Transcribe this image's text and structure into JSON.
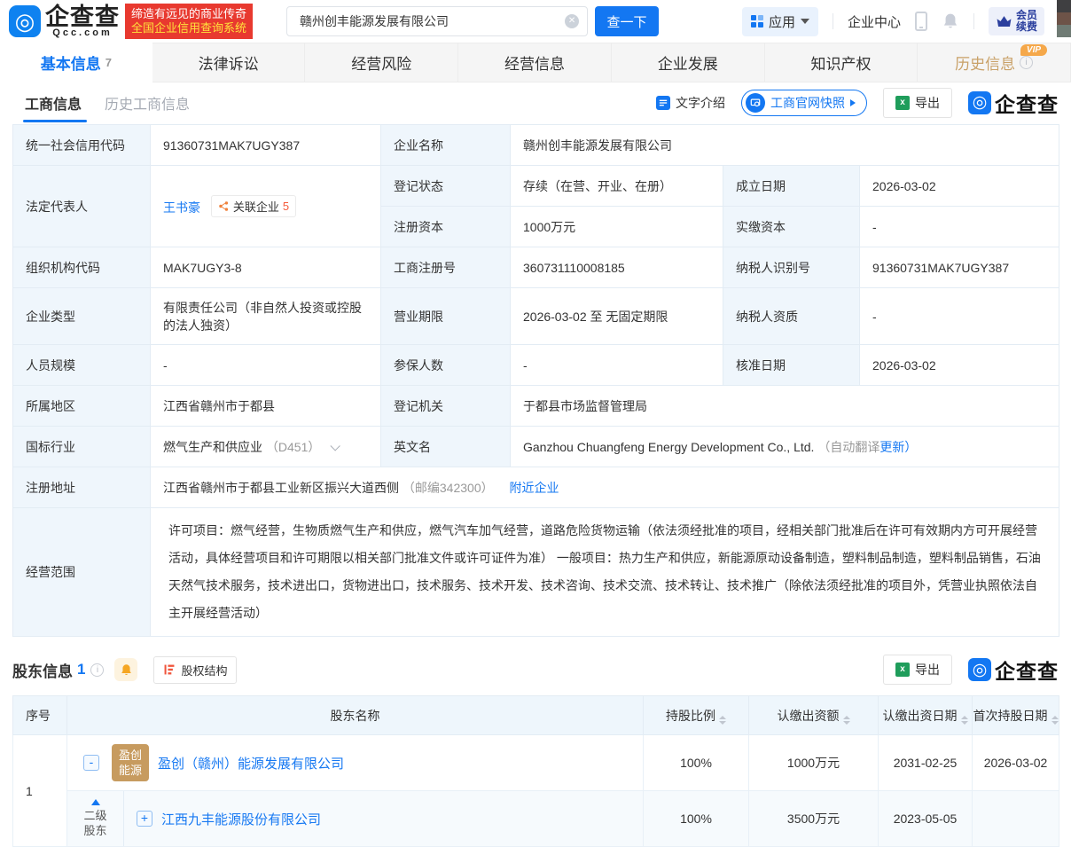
{
  "colors": {
    "accent_blue": "#1377f2",
    "link_blue": "#1678f2",
    "banner_red": "#e8392f",
    "label_cell_bg": "#eff6fc",
    "history_tab_tan": "#c9a168",
    "avatar_gold": "#c79b5f"
  },
  "header": {
    "logo_title": "企查查",
    "logo_subtitle": "Qcc.com",
    "banner_line1": "缔造有远见的商业传奇",
    "banner_line2": "全国企业信用查询系统",
    "search_value": "赣州创丰能源发展有限公司",
    "search_button": "查一下",
    "apps_label": "应用",
    "enterprise_center": "企业中心",
    "vip_renew_line1": "会员",
    "vip_renew_line2": "续费"
  },
  "nav": {
    "tabs": [
      {
        "label": "基本信息",
        "count": "7"
      },
      {
        "label": "法律诉讼"
      },
      {
        "label": "经营风险"
      },
      {
        "label": "经营信息"
      },
      {
        "label": "企业发展"
      },
      {
        "label": "知识产权"
      },
      {
        "label": "历史信息",
        "vip": "VIP"
      }
    ]
  },
  "toolbar": {
    "tab_business": "工商信息",
    "tab_history": "历史工商信息",
    "text_intro": "文字介绍",
    "official_snapshot": "工商官网快照",
    "export_label": "导出",
    "qcc_logo": "企查查"
  },
  "company": {
    "credit_code_label": "统一社会信用代码",
    "credit_code": "91360731MAK7UGY387",
    "name_label": "企业名称",
    "name": "赣州创丰能源发展有限公司",
    "legal_rep_label": "法定代表人",
    "legal_rep": "王书豪",
    "related_companies": "关联企业",
    "related_count": "5",
    "reg_status_label": "登记状态",
    "reg_status": "存续（在营、开业、在册）",
    "establish_date_label": "成立日期",
    "establish_date": "2026-03-02",
    "reg_capital_label": "注册资本",
    "reg_capital": "1000万元",
    "paid_capital_label": "实缴资本",
    "paid_capital": "-",
    "org_code_label": "组织机构代码",
    "org_code": "MAK7UGY3-8",
    "reg_no_label": "工商注册号",
    "reg_no": "360731110008185",
    "taxpayer_id_label": "纳税人识别号",
    "taxpayer_id": "91360731MAK7UGY387",
    "company_type_label": "企业类型",
    "company_type": "有限责任公司（非自然人投资或控股的法人独资）",
    "business_term_label": "营业期限",
    "business_term": "2026-03-02 至 无固定期限",
    "taxpayer_quality_label": "纳税人资质",
    "taxpayer_quality": "-",
    "staff_size_label": "人员规模",
    "staff_size": "-",
    "insured_label": "参保人数",
    "insured": "-",
    "approval_date_label": "核准日期",
    "approval_date": "2026-03-02",
    "region_label": "所属地区",
    "region": "江西省赣州市于都县",
    "reg_authority_label": "登记机关",
    "reg_authority": "于都县市场监督管理局",
    "industry_label": "国标行业",
    "industry": "燃气生产和供应业",
    "industry_code": "（D451）",
    "english_name_label": "英文名",
    "english_name": "Ganzhou Chuangfeng Energy Development Co., Ltd.",
    "auto_translate_note": "（自动翻译",
    "update_link": "更新）",
    "address_label": "注册地址",
    "address": "江西省赣州市于都县工业新区振兴大道西侧",
    "postcode": "（邮编342300）",
    "nearby_link": "附近企业",
    "business_scope_label": "经营范围",
    "business_scope": "许可项目：燃气经营，生物质燃气生产和供应，燃气汽车加气经营，道路危险货物运输（依法须经批准的项目，经相关部门批准后在许可有效期内方可开展经营活动，具体经营项目和许可期限以相关部门批准文件或许可证件为准） 一般项目：热力生产和供应，新能源原动设备制造，塑料制品制造，塑料制品销售，石油天然气技术服务，技术进出口，货物进出口，技术服务、技术开发、技术咨询、技术交流、技术转让、技术推广（除依法须经批准的项目外，凭营业执照依法自主开展经营活动）"
  },
  "shareholders": {
    "title": "股东信息",
    "count": "1",
    "equity_structure": "股权结构",
    "export_label": "导出",
    "qcc_logo": "企查查",
    "columns": [
      "序号",
      "股东名称",
      "持股比例",
      "认缴出资额",
      "认缴出资日期",
      "首次持股日期"
    ],
    "rows": [
      {
        "seq": "1",
        "avatar_line1": "盈创",
        "avatar_line2": "能源",
        "name": "盈创（赣州）能源发展有限公司",
        "ratio": "100%",
        "amount": "1000万元",
        "date": "2031-02-25",
        "first_date": "2026-03-02"
      },
      {
        "level_line1": "二级",
        "level_line2": "股东",
        "name": "江西九丰能源股份有限公司",
        "ratio": "100%",
        "amount": "3500万元",
        "date": "2023-05-05",
        "first_date": ""
      }
    ]
  }
}
